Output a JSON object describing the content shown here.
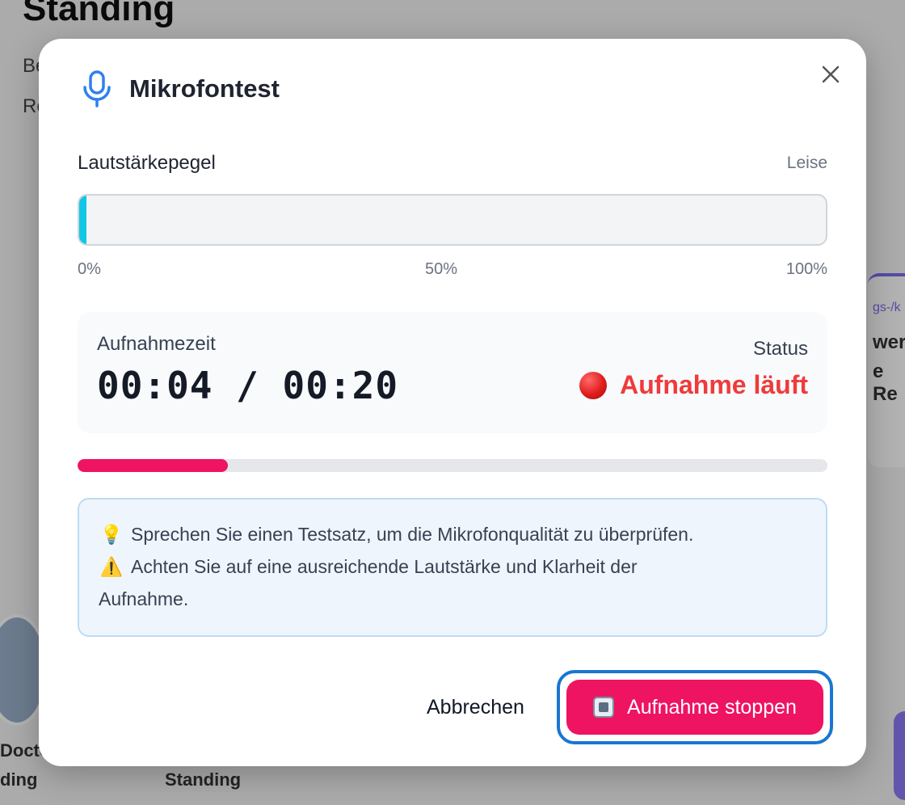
{
  "background": {
    "heading": "Standing",
    "line1": "Be",
    "line2": "Re",
    "card_link": "gs-/k",
    "card_title1": "wer",
    "card_title2": "e Re",
    "label_doctor": "Docto",
    "label_standing_left": "ding",
    "label_standing": "Standing"
  },
  "modal": {
    "icon": "microphone-icon",
    "title": "Mikrofontest",
    "close_icon": "close-icon"
  },
  "level": {
    "label": "Lautstärkepegel",
    "status": "Leise",
    "fill_percent": 1,
    "fill_color": "#12c6e6",
    "ticks": [
      "0%",
      "50%",
      "100%"
    ]
  },
  "recording": {
    "time_label": "Aufnahmezeit",
    "time": "00:04 / 00:20",
    "status_label": "Status",
    "status_icon": "red-circle-icon",
    "status_text": "Aufnahme läuft",
    "status_color": "#ef3b3b",
    "progress_fraction": 0.2,
    "progress_color": "#ee1461"
  },
  "tips": {
    "tip1_icon": "💡",
    "tip1_text": "Sprechen Sie einen Testsatz, um die Mikrofonqualität zu überprüfen.",
    "tip2_icon": "⚠️",
    "tip2_text_line1": "Achten Sie auf eine ausreichende Lautstärke und Klarheit der",
    "tip2_text_line2": "Aufnahme."
  },
  "actions": {
    "cancel_label": "Abbrechen",
    "stop_icon": "stop-square-icon",
    "stop_label": "Aufnahme stoppen",
    "stop_color": "#ee1461"
  }
}
